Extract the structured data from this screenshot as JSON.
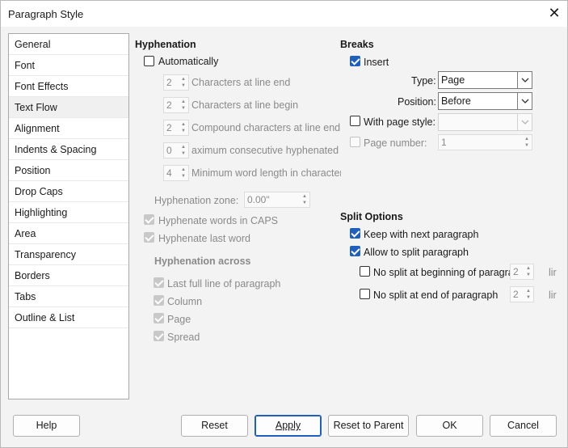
{
  "window": {
    "title": "Paragraph Style"
  },
  "sidebar": {
    "items": [
      {
        "label": "General"
      },
      {
        "label": "Font"
      },
      {
        "label": "Font Effects"
      },
      {
        "label": "Text Flow"
      },
      {
        "label": "Alignment"
      },
      {
        "label": "Indents & Spacing"
      },
      {
        "label": "Position"
      },
      {
        "label": "Drop Caps"
      },
      {
        "label": "Highlighting"
      },
      {
        "label": "Area"
      },
      {
        "label": "Transparency"
      },
      {
        "label": "Borders"
      },
      {
        "label": "Tabs"
      },
      {
        "label": "Outline & List"
      }
    ],
    "selected": "Text Flow"
  },
  "hyphenation": {
    "heading": "Hyphenation",
    "automatically": {
      "label": "Automatically",
      "checked": false
    },
    "chars_line_end": {
      "value": "2",
      "label": "Characters at line end"
    },
    "chars_line_begin": {
      "value": "2",
      "label": "Characters at line begin"
    },
    "compound_chars": {
      "value": "2",
      "label": "Compound characters at line end"
    },
    "max_consecutive": {
      "value": "0",
      "label": "aximum consecutive hyphenated lir"
    },
    "min_word_length": {
      "value": "4",
      "label": "Minimum word length in characters"
    },
    "zone": {
      "label": "Hyphenation zone:",
      "value": "0.00\""
    },
    "caps": {
      "label": "Hyphenate words in CAPS",
      "checked": true
    },
    "last_word": {
      "label": "Hyphenate last word",
      "checked": true
    },
    "across_heading": "Hyphenation across",
    "last_full_line": {
      "label": "Last full line of paragraph",
      "checked": true
    },
    "column": {
      "label": "Column",
      "checked": true
    },
    "page": {
      "label": "Page",
      "checked": true
    },
    "spread": {
      "label": "Spread",
      "checked": true
    }
  },
  "breaks": {
    "heading": "Breaks",
    "insert": {
      "label": "Insert",
      "checked": true
    },
    "type": {
      "label": "Type:",
      "value": "Page"
    },
    "position": {
      "label": "Position:",
      "value": "Before"
    },
    "with_page_style": {
      "label": "With page style:",
      "checked": false,
      "value": ""
    },
    "page_number": {
      "label": "Page number:",
      "value": "1"
    }
  },
  "split": {
    "heading": "Split Options",
    "keep_next": {
      "label": "Keep with next paragraph",
      "checked": true
    },
    "allow_split": {
      "label": "Allow to split paragraph",
      "checked": true
    },
    "no_split_begin": {
      "label": "No split at beginning of paragrap",
      "value": "2",
      "unit": "lir"
    },
    "no_split_end": {
      "label": "No split at end of paragraph",
      "value": "2",
      "unit": "lir"
    }
  },
  "buttons": {
    "help": "Help",
    "reset": "Reset",
    "apply": "Apply",
    "reset_parent": "Reset to Parent",
    "ok": "OK",
    "cancel": "Cancel"
  },
  "colors": {
    "accent": "#1f5fbf"
  }
}
